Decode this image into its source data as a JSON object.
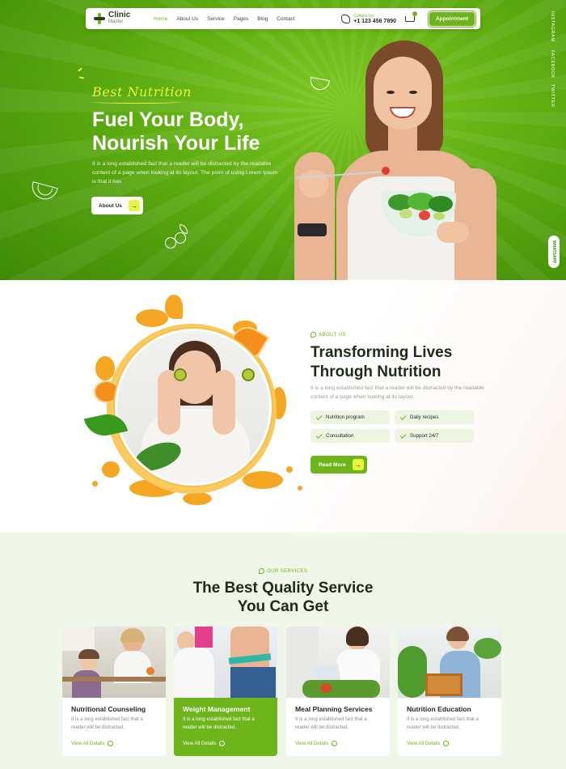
{
  "nav": {
    "logo_title": "Clinic",
    "logo_sub": "Master",
    "items": [
      "Home",
      "About Us",
      "Service",
      "Pages",
      "Blog",
      "Contact"
    ],
    "contact_label": "Contact Us",
    "phone": "+1 123 456 7890",
    "cart_count": "0",
    "appointment_label": "Appointment",
    "accent": "#6db51a"
  },
  "hero": {
    "tagline": "Best Nutrition",
    "headline_line1": "Fuel Your Body,",
    "headline_line2": "Nourish Your Life",
    "description": "It is a long established fact that a reader will be distracted by the readable content of a page when looking at its layout. The point of using Lorem Ipsum is that it has",
    "cta_label": "About Us",
    "social": [
      "INSTAGRAM",
      "FACEBOOK",
      "TWITTER"
    ],
    "side_pill": "WHATSAPP",
    "bg_color": "#5fae12",
    "tagline_color": "#e8f540"
  },
  "about": {
    "eyebrow": "ABOUT US",
    "title_line1": "Transforming Lives",
    "title_line2": "Through Nutrition",
    "description": "It is a long established fact that a reader will be distracted by the readable content of a page when looking at its layout.",
    "features": [
      "Nutrition program",
      "Daily recipes",
      "Consultation",
      "Support 24/7"
    ],
    "cta_label": "Read More"
  },
  "services": {
    "eyebrow": "OUR SERVICES",
    "title_line1": "The Best Quality Service",
    "title_line2": "You Can Get",
    "cards": [
      {
        "title": "Nutritional Counseling",
        "desc": "It is a long established fact that a reader will be distracted.",
        "link": "View All Details"
      },
      {
        "title": "Weight Management",
        "desc": "It is a long established fact that a reader will be distracted.",
        "link": "View All Details"
      },
      {
        "title": "Meal Planning Services",
        "desc": "It is a long established fact that a reader will be distracted.",
        "link": "View All Details"
      },
      {
        "title": "Nutrition Education",
        "desc": "It is a long established fact that a reader will be distracted.",
        "link": "View All Details"
      }
    ]
  }
}
